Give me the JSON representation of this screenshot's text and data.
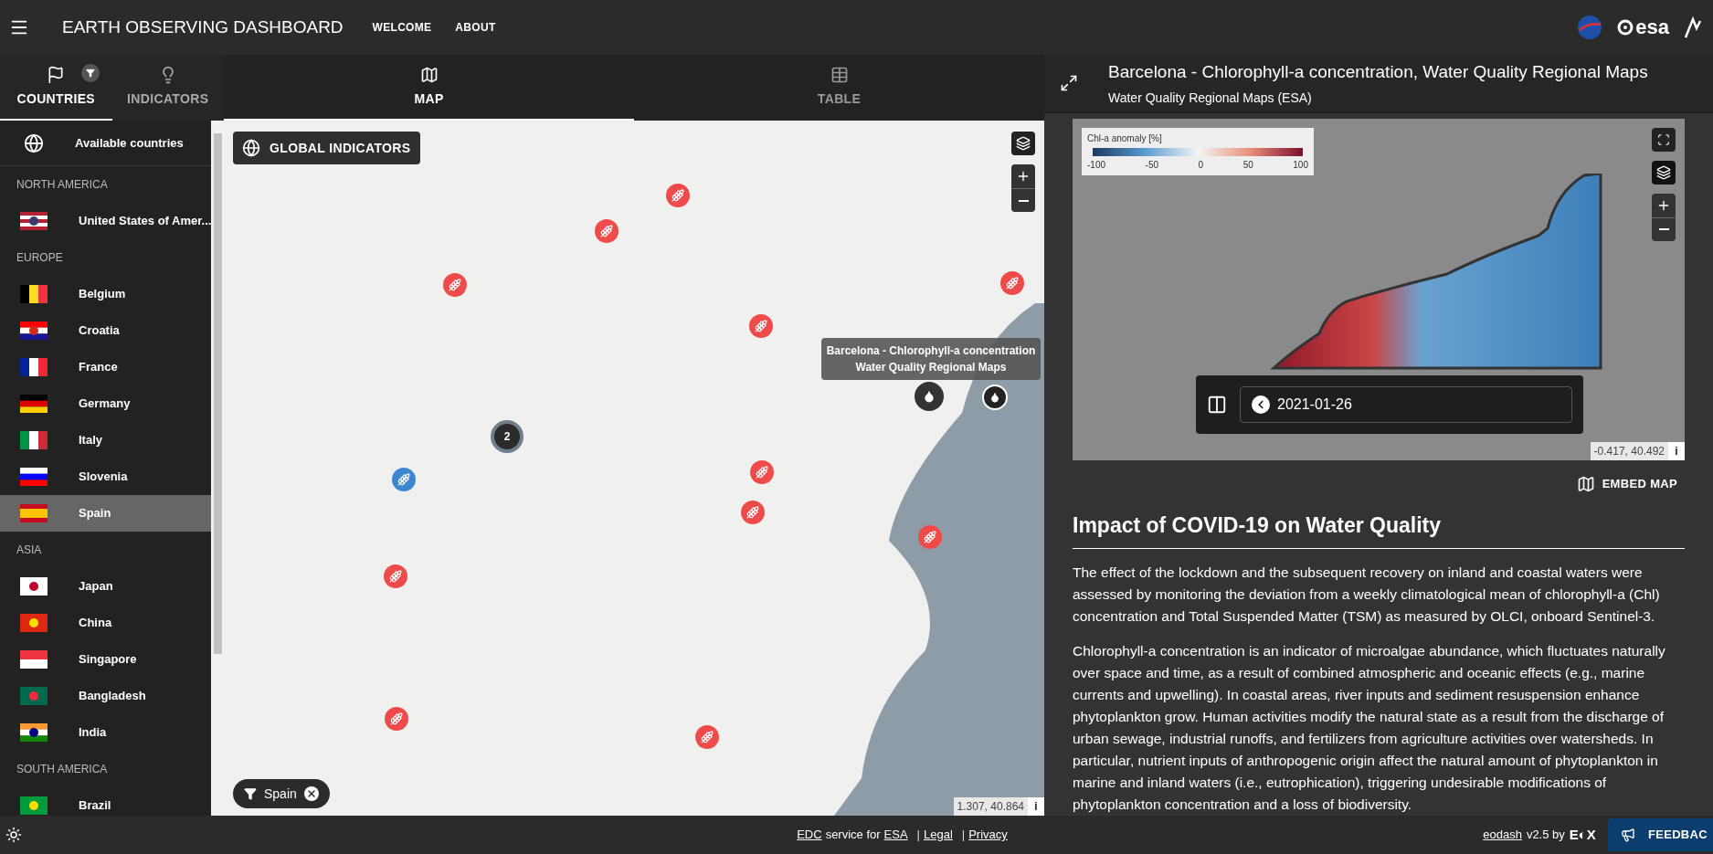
{
  "header": {
    "title": "EARTH OBSERVING DASHBOARD",
    "nav": [
      {
        "label": "WELCOME"
      },
      {
        "label": "ABOUT"
      }
    ],
    "partner_logo_text": "esa"
  },
  "sidebar": {
    "tabs": [
      {
        "label": "COUNTRIES",
        "selected": true,
        "filter_badge": true
      },
      {
        "label": "INDICATORS",
        "selected": false,
        "filter_badge": false
      }
    ],
    "all_item": "Available countries",
    "groups": [
      {
        "title": "NORTH AMERICA",
        "countries": [
          {
            "name": "United States of Amer...",
            "selected": false
          }
        ]
      },
      {
        "title": "EUROPE",
        "countries": [
          {
            "name": "Belgium",
            "selected": false
          },
          {
            "name": "Croatia",
            "selected": false
          },
          {
            "name": "France",
            "selected": false
          },
          {
            "name": "Germany",
            "selected": false
          },
          {
            "name": "Italy",
            "selected": false
          },
          {
            "name": "Slovenia",
            "selected": false
          },
          {
            "name": "Spain",
            "selected": true
          }
        ]
      },
      {
        "title": "ASIA",
        "countries": [
          {
            "name": "Japan",
            "selected": false
          },
          {
            "name": "China",
            "selected": false
          },
          {
            "name": "Singapore",
            "selected": false
          },
          {
            "name": "Bangladesh",
            "selected": false
          },
          {
            "name": "India",
            "selected": false
          }
        ]
      },
      {
        "title": "SOUTH AMERICA",
        "countries": [
          {
            "name": "Brazil",
            "selected": false
          }
        ]
      }
    ]
  },
  "main_tabs": [
    {
      "label": "MAP",
      "selected": true
    },
    {
      "label": "TABLE",
      "selected": false
    }
  ],
  "map": {
    "global_button": "GLOBAL INDICATORS",
    "cluster_count": "2",
    "tooltip": {
      "title": "Barcelona - Chlorophyll-a concentration",
      "subtitle": "Water Quality Regional Maps"
    },
    "filter_chip": "Spain",
    "coordinates": "1.307, 40.864",
    "info": "i"
  },
  "detail": {
    "title": "Barcelona - Chlorophyll-a concentration, Water Quality Regional Maps",
    "subtitle": "Water Quality Regional Maps (ESA)",
    "map": {
      "legend": {
        "title": "Chl-a anomaly [%]",
        "ticks": [
          "-100",
          "-50",
          "0",
          "50",
          "100"
        ]
      },
      "date": "2021-01-26",
      "coordinates": "-0.417, 40.492",
      "info": "i"
    },
    "embed_button": "EMBED MAP",
    "heading": "Impact of COVID-19 on Water Quality",
    "paragraphs": [
      "The effect of the lockdown and the subsequent recovery on inland and coastal waters were assessed by monitoring the deviation from a weekly climatological mean of chlorophyll-a (Chl) concentration and Total Suspended Matter (TSM) as measured by OLCI, onboard Sentinel-3.",
      "Chlorophyll-a concentration is an indicator of microalgae abundance, which fluctuates naturally over space and time, as a result of combined atmospheric and oceanic effects (e.g., marine currents and upwelling). In coastal areas, river inputs and sediment resuspension enhance phytoplankton grow. Human activities modify the natural state as a result from the discharge of urban sewage, industrial runoffs, and fertilizers from agriculture activities over watersheds. In particular, nutrient inputs of anthropogenic origin affect the natural amount of phytoplankton in marine and inland waters (i.e., eutrophication), triggering undesirable modifications of phytoplankton concentration and a loss of biodiversity."
    ]
  },
  "footer": {
    "credits": [
      {
        "text": "EDC",
        "kind": "link"
      },
      {
        "text": "service for",
        "kind": "text"
      },
      {
        "text": "ESA",
        "kind": "link"
      },
      {
        "text": "|",
        "kind": "separator"
      },
      {
        "text": "Legal",
        "kind": "link"
      },
      {
        "text": "|",
        "kind": "separator"
      },
      {
        "text": "Privacy",
        "kind": "link"
      }
    ],
    "version_link": "eodash",
    "version_text": "v2.5 by",
    "vendor_logo": "E◐X",
    "feedback": "FEEDBAC"
  }
}
